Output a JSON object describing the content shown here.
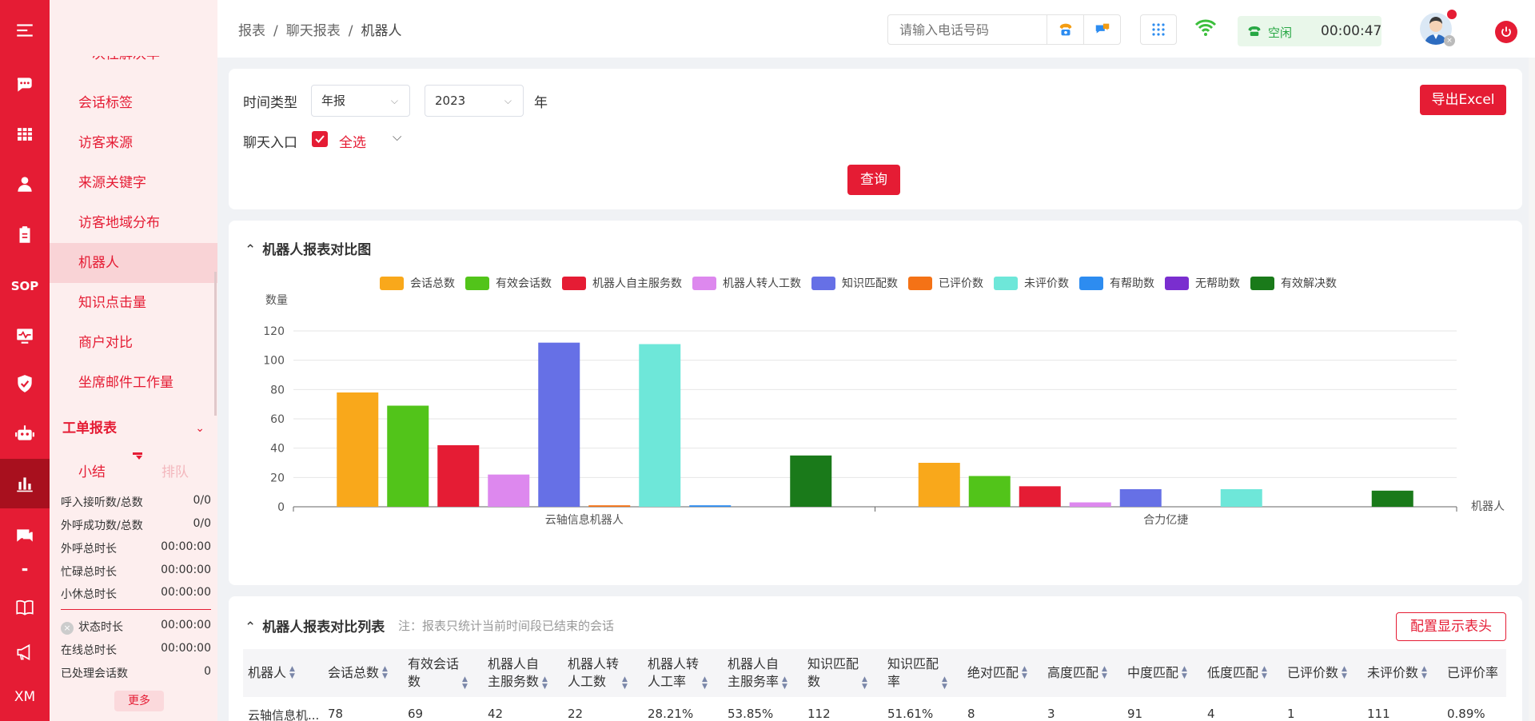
{
  "rail": {
    "icons": [
      "menu-icon",
      "chat-icon",
      "table-icon",
      "user-icon",
      "clipboard-icon",
      "sop-icon",
      "monitor-icon",
      "shield-icon",
      "robot-icon",
      "bar-chart-icon",
      "message-icon",
      "book-icon",
      "megaphone-icon",
      "xm-icon"
    ],
    "sop_label": "SOP",
    "xm_label": "XM"
  },
  "submenu": {
    "items": [
      "一次性解决率",
      "会话标签",
      "访客来源",
      "来源关键字",
      "访客地域分布",
      "机器人",
      "知识点击量",
      "商户对比",
      "坐席邮件工作量"
    ],
    "active": "机器人",
    "group": "工单报表"
  },
  "mini_tabs": {
    "tab1": "小结",
    "tab2": "排队"
  },
  "stats": {
    "rows": [
      {
        "label": "呼入接听数/总数",
        "value": "0/0"
      },
      {
        "label": "外呼成功数/总数",
        "value": "0/0"
      },
      {
        "label": "外呼总时长",
        "value": "00:00:00"
      },
      {
        "label": "忙碌总时长",
        "value": "00:00:00"
      },
      {
        "label": "小休总时长",
        "value": "00:00:00"
      }
    ],
    "rows2": [
      {
        "label": "状态时长",
        "value": "00:00:00"
      },
      {
        "label": "在线总时长",
        "value": "00:00:00"
      },
      {
        "label": "已处理会话数",
        "value": "0"
      }
    ],
    "more": "更多"
  },
  "header": {
    "breadcrumb": [
      "报表",
      "聊天报表",
      "机器人"
    ],
    "phone_placeholder": "请输入电话号码",
    "status": "空闲",
    "timer": "00:00:47"
  },
  "filter": {
    "time_type_label": "时间类型",
    "time_type_value": "年报",
    "year_value": "2023",
    "year_unit": "年",
    "entry_label": "聊天入口",
    "select_all": "全选",
    "export": "导出Excel",
    "query": "查询"
  },
  "chart_section": {
    "title": "机器人报表对比图"
  },
  "chart_data": {
    "type": "bar",
    "ylabel": "数量",
    "xlabel": "机器人",
    "ylim": [
      0,
      120
    ],
    "yticks": [
      0,
      20,
      40,
      60,
      80,
      100,
      120
    ],
    "categories": [
      "云轴信息机器人",
      "合力亿捷"
    ],
    "series": [
      {
        "name": "会话总数",
        "color": "#f9a81b",
        "values": [
          78,
          30
        ]
      },
      {
        "name": "有效会话数",
        "color": "#52c41a",
        "values": [
          69,
          21
        ]
      },
      {
        "name": "机器人自主服务数",
        "color": "#e51c34",
        "values": [
          42,
          14
        ]
      },
      {
        "name": "机器人转人工数",
        "color": "#dd88ee",
        "values": [
          22,
          3
        ]
      },
      {
        "name": "知识匹配数",
        "color": "#6670e6",
        "values": [
          112,
          12
        ]
      },
      {
        "name": "已评价数",
        "color": "#f47216",
        "values": [
          1,
          0
        ]
      },
      {
        "name": "未评价数",
        "color": "#6ee7d9",
        "values": [
          111,
          12
        ]
      },
      {
        "name": "有帮助数",
        "color": "#2d8cf0",
        "values": [
          1,
          0
        ]
      },
      {
        "name": "无帮助数",
        "color": "#7a2ecf",
        "values": [
          0,
          0
        ]
      },
      {
        "name": "有效解决数",
        "color": "#1a7a1a",
        "values": [
          35,
          11
        ]
      }
    ]
  },
  "table_section": {
    "title": "机器人报表对比列表",
    "note": "注：报表只统计当前时间段已结束的会话",
    "config_btn": "配置显示表头",
    "headers": [
      "机器人",
      "会话总数",
      "有效会话数",
      "机器人自主服务数",
      "机器人转人工数",
      "机器人转人工率",
      "机器人自主服务率",
      "知识匹配数",
      "知识匹配率",
      "绝对匹配",
      "高度匹配",
      "中度匹配",
      "低度匹配",
      "已评价数",
      "未评价数",
      "已评价率"
    ],
    "rows": [
      [
        "云轴信息机...",
        "78",
        "69",
        "42",
        "22",
        "28.21%",
        "53.85%",
        "112",
        "51.61%",
        "8",
        "3",
        "91",
        "4",
        "1",
        "111",
        "0.89%"
      ]
    ]
  }
}
